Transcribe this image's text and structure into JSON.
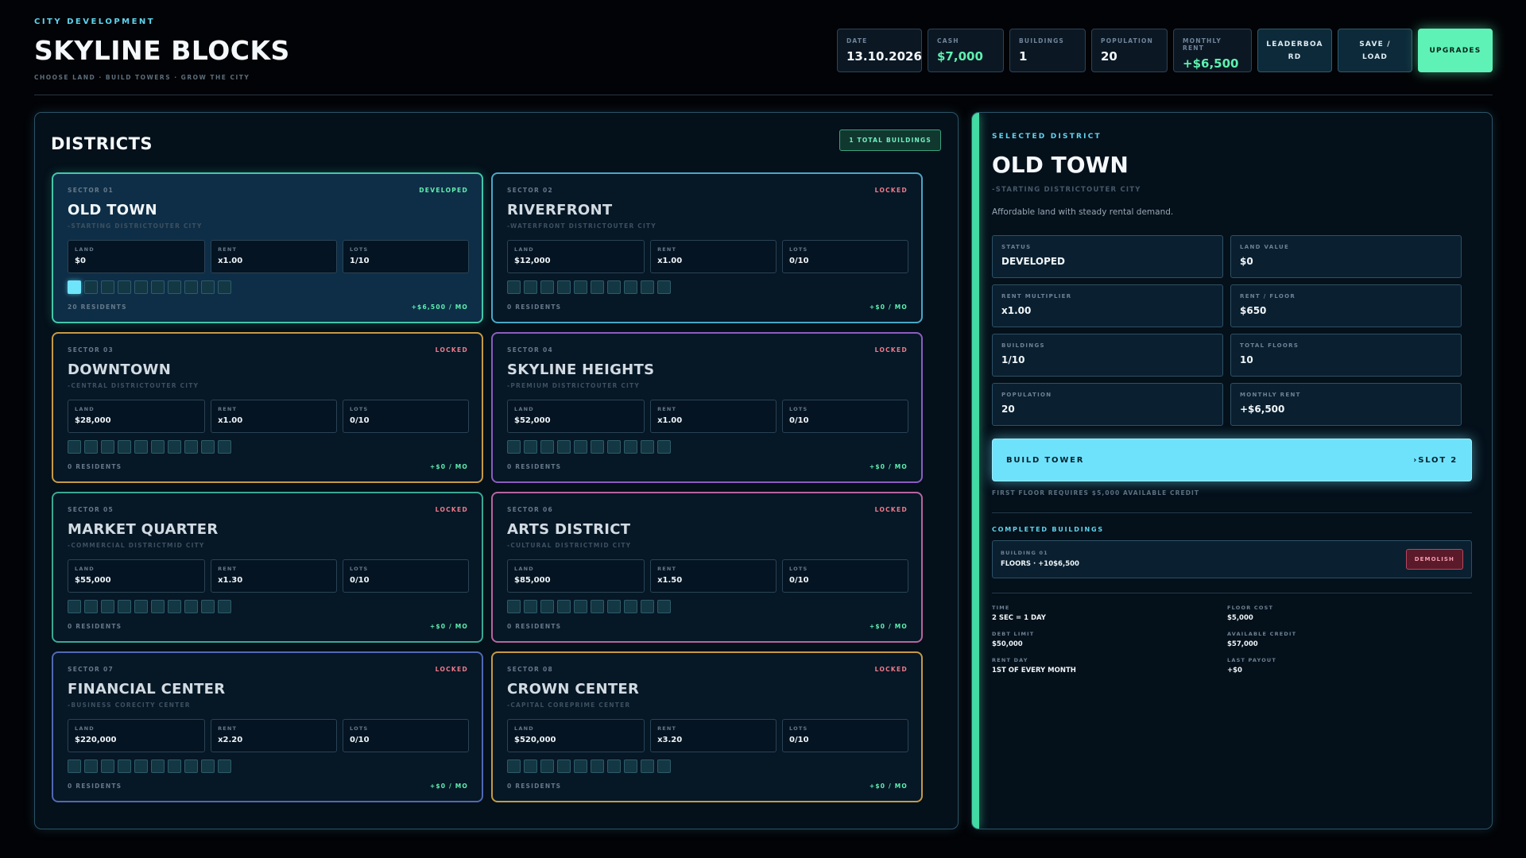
{
  "header": {
    "eyebrow": "CITY DEVELOPMENT",
    "title": "SKYLINE BLOCKS",
    "tagline": "CHOOSE LAND · BUILD TOWERS · GROW THE CITY"
  },
  "stats": [
    {
      "label": "DATE",
      "value": "13.10.2026"
    },
    {
      "label": "CASH",
      "value": "$7,000"
    },
    {
      "label": "BUILDINGS",
      "value": "1"
    },
    {
      "label": "POPULATION",
      "value": "20"
    },
    {
      "label": "MONTHLY RENT",
      "value": "+$6,500"
    }
  ],
  "buttons": {
    "leaderboard": "LEADERBOARD",
    "save_load": "SAVE / LOAD",
    "upgrades": "UPGRADES"
  },
  "districts_panel": {
    "title": "DISTRICTS",
    "total_badge": "1 TOTAL BUILDINGS"
  },
  "labels": {
    "land": "LAND",
    "rent": "RENT",
    "lots": "LOTS"
  },
  "districts": [
    {
      "sector": "SECTOR 01",
      "status": "DEVELOPED",
      "name": "OLD TOWN",
      "sub": "-STARTING DISTRICTOUTER CITY",
      "land": "$0",
      "rent": "x1.00",
      "lots": "1/10",
      "lots_filled": 1,
      "residents": "20 RESIDENTS",
      "income": "+$6,500 / MO",
      "border": "#44c7a9"
    },
    {
      "sector": "SECTOR 02",
      "status": "LOCKED",
      "name": "RIVERFRONT",
      "sub": "-WATERFRONT DISTRICTOUTER CITY",
      "land": "$12,000",
      "rent": "x1.00",
      "lots": "0/10",
      "lots_filled": 0,
      "residents": "0 RESIDENTS",
      "income": "+$0 / MO",
      "border": "#4aa7c6"
    },
    {
      "sector": "SECTOR 03",
      "status": "LOCKED",
      "name": "DOWNTOWN",
      "sub": "-CENTRAL DISTRICTOUTER CITY",
      "land": "$28,000",
      "rent": "x1.00",
      "lots": "0/10",
      "lots_filled": 0,
      "residents": "0 RESIDENTS",
      "income": "+$0 / MO",
      "border": "#c59a45"
    },
    {
      "sector": "SECTOR 04",
      "status": "LOCKED",
      "name": "SKYLINE HEIGHTS",
      "sub": "-PREMIUM DISTRICTOUTER CITY",
      "land": "$52,000",
      "rent": "x1.00",
      "lots": "0/10",
      "lots_filled": 0,
      "residents": "0 RESIDENTS",
      "income": "+$0 / MO",
      "border": "#8b5dc0"
    },
    {
      "sector": "SECTOR 05",
      "status": "LOCKED",
      "name": "MARKET QUARTER",
      "sub": "-COMMERCIAL DISTRICTMID CITY",
      "land": "$55,000",
      "rent": "x1.30",
      "lots": "0/10",
      "lots_filled": 0,
      "residents": "0 RESIDENTS",
      "income": "+$0 / MO",
      "border": "#3aa893"
    },
    {
      "sector": "SECTOR 06",
      "status": "LOCKED",
      "name": "ARTS DISTRICT",
      "sub": "-CULTURAL DISTRICTMID CITY",
      "land": "$85,000",
      "rent": "x1.50",
      "lots": "0/10",
      "lots_filled": 0,
      "residents": "0 RESIDENTS",
      "income": "+$0 / MO",
      "border": "#b7659f"
    },
    {
      "sector": "SECTOR 07",
      "status": "LOCKED",
      "name": "FINANCIAL CENTER",
      "sub": "-BUSINESS CORECITY CENTER",
      "land": "$220,000",
      "rent": "x2.20",
      "lots": "0/10",
      "lots_filled": 0,
      "residents": "0 RESIDENTS",
      "income": "+$0 / MO",
      "border": "#5168b3"
    },
    {
      "sector": "SECTOR 08",
      "status": "LOCKED",
      "name": "CROWN CENTER",
      "sub": "-CAPITAL COREPRIME CENTER",
      "land": "$520,000",
      "rent": "x3.20",
      "lots": "0/10",
      "lots_filled": 0,
      "residents": "0 RESIDENTS",
      "income": "+$0 / MO",
      "border": "#c59a45"
    }
  ],
  "detail": {
    "eyebrow": "SELECTED DISTRICT",
    "title": "OLD TOWN",
    "sub": "-STARTING DISTRICTOUTER CITY",
    "description": "Affordable land with steady rental demand.",
    "cells": [
      {
        "label": "STATUS",
        "value": "DEVELOPED"
      },
      {
        "label": "LAND VALUE",
        "value": "$0"
      },
      {
        "label": "RENT MULTIPLIER",
        "value": "x1.00"
      },
      {
        "label": "RENT / FLOOR",
        "value": "$650"
      },
      {
        "label": "BUILDINGS",
        "value": "1/10"
      },
      {
        "label": "TOTAL FLOORS",
        "value": "10"
      },
      {
        "label": "POPULATION",
        "value": "20"
      },
      {
        "label": "MONTHLY RENT",
        "value": "+$6,500"
      }
    ],
    "build_label": "BUILD TOWER",
    "build_slot": "›SLOT 2",
    "build_note": "FIRST FLOOR REQUIRES $5,000 AVAILABLE CREDIT",
    "completed_title": "COMPLETED BUILDINGS",
    "completed": {
      "label": "BUILDING 01",
      "value": "FLOORS · +10$6,500",
      "demolish": "DEMOLISH"
    },
    "info": [
      {
        "label": "TIME",
        "value": "2 SEC = 1 DAY"
      },
      {
        "label": "FLOOR COST",
        "value": "$5,000"
      },
      {
        "label": "DEBT LIMIT",
        "value": "$50,000"
      },
      {
        "label": "AVAILABLE CREDIT",
        "value": "$57,000"
      },
      {
        "label": "RENT DAY",
        "value": "1ST OF EVERY MONTH"
      },
      {
        "label": "LAST PAYOUT",
        "value": "+$0"
      }
    ]
  },
  "colors": {
    "accent_cyan": "#6fe2fb",
    "accent_green": "#5ef2b6",
    "locked_red": "#f07b8a"
  }
}
